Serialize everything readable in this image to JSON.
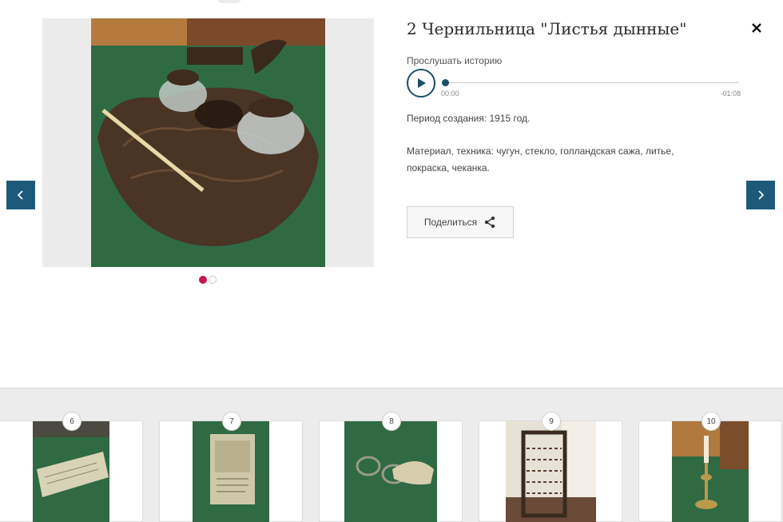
{
  "item": {
    "title": "2 Чернильница \"Листья дынные\"",
    "listen_label": "Прослушать историю",
    "period": "Период создания: 1915 год.",
    "material": "Материал, техника: чугун, стекло, голландская сажа, литье, покраска, чеканка.",
    "share_label": "Поделиться"
  },
  "player": {
    "time_current": "00:00",
    "time_remaining": "-01:08",
    "progress": 0
  },
  "gallery": {
    "slide_count": 2,
    "active_slide": 1
  },
  "thumbnails": [
    {
      "number": "6"
    },
    {
      "number": "7"
    },
    {
      "number": "8"
    },
    {
      "number": "9"
    },
    {
      "number": "10"
    }
  ],
  "colors": {
    "accent": "#1d5a7a",
    "active_dot": "#c8174a",
    "table_green": "#2f6a43"
  }
}
